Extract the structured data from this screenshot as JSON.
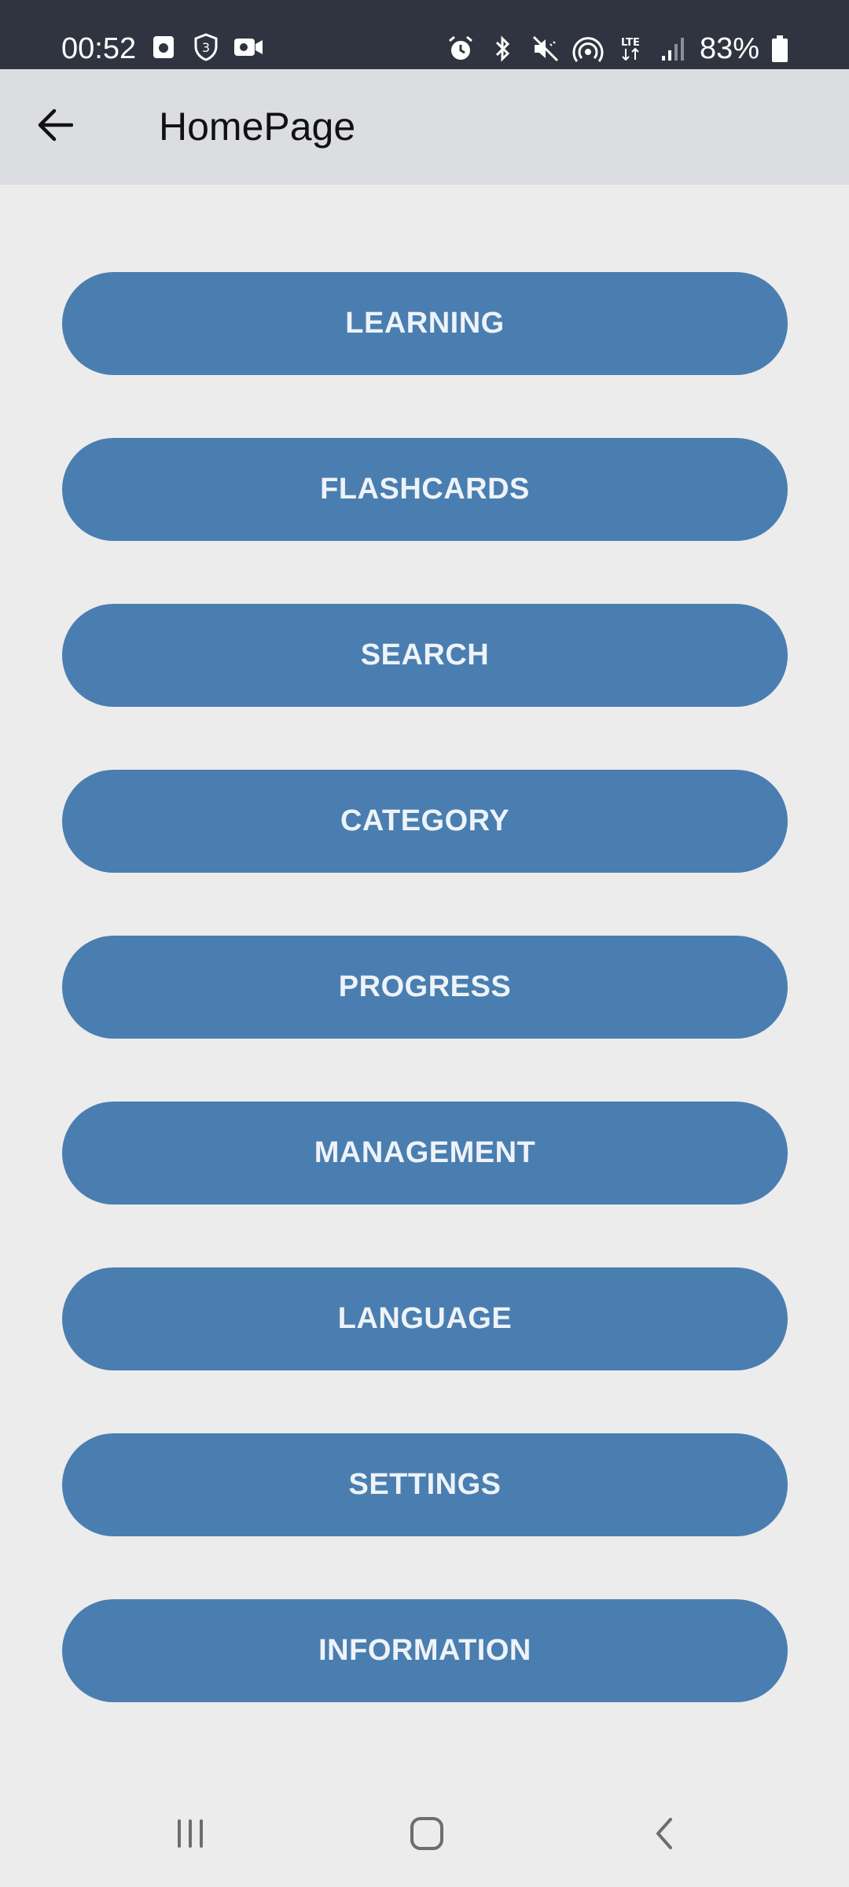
{
  "status_bar": {
    "time": "00:52",
    "battery": "83%",
    "left_icons": [
      "calendar-icon",
      "shield-3-icon",
      "video-icon"
    ],
    "right_icons": [
      "alarm-icon",
      "bluetooth-icon",
      "mute-icon",
      "hotspot-icon",
      "lte-icon",
      "signal-icon",
      "battery-icon"
    ]
  },
  "app_bar": {
    "title": "HomePage",
    "back_icon": "arrow-left-icon"
  },
  "menu": {
    "items": [
      {
        "label": "LEARNING"
      },
      {
        "label": "FLASHCARDS"
      },
      {
        "label": "SEARCH"
      },
      {
        "label": "CATEGORY"
      },
      {
        "label": "PROGRESS"
      },
      {
        "label": "MANAGEMENT"
      },
      {
        "label": "LANGUAGE"
      },
      {
        "label": "SETTINGS"
      },
      {
        "label": "INFORMATION"
      }
    ]
  },
  "nav_bar": {
    "icons": [
      "recent-apps-icon",
      "home-icon",
      "back-icon"
    ]
  },
  "colors": {
    "status_bar": "#2f3440",
    "app_bar": "#dcdde0",
    "background": "#ececec",
    "button": "#4a7eb0",
    "button_text": "#eef3f9"
  }
}
